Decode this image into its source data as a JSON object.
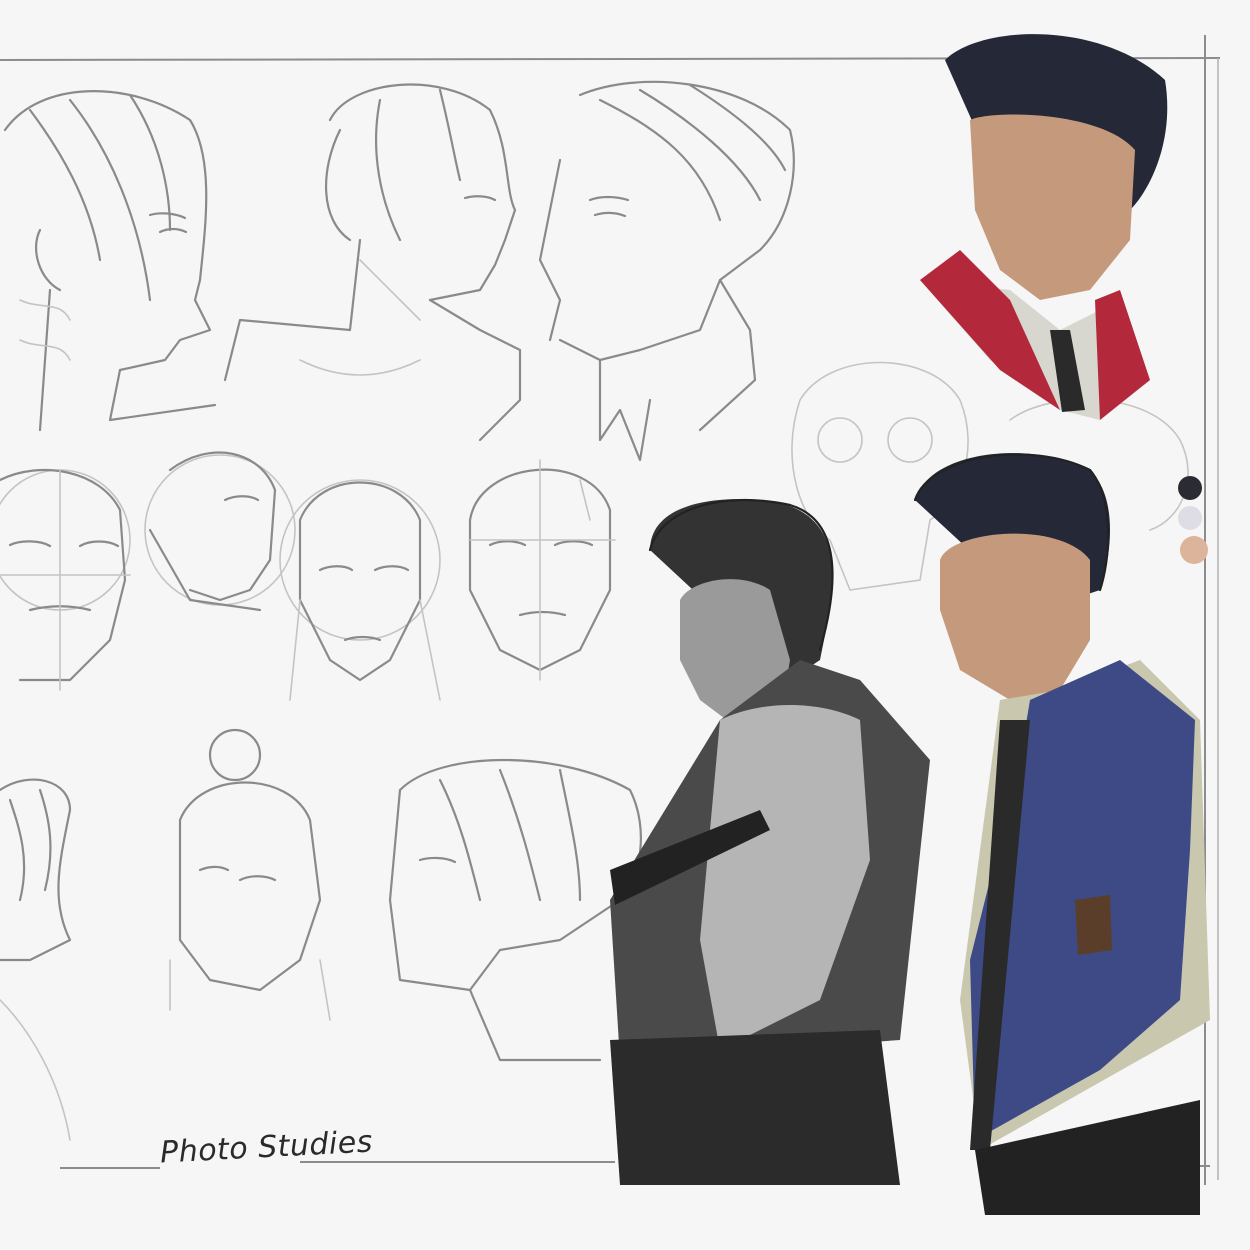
{
  "sheet": {
    "caption": "Photo Studies"
  },
  "palette": {
    "swatches": [
      "#2b2c33",
      "#dedde6",
      "#dcb49c"
    ]
  },
  "colors": {
    "paper": "#f6f6f6",
    "frame": "#8c8c8c",
    "hair": "#252836",
    "skin": "#c59a7c",
    "vest": "#3d4a86",
    "shirt": "#c9c7ae",
    "lapel": "#b3283a"
  }
}
